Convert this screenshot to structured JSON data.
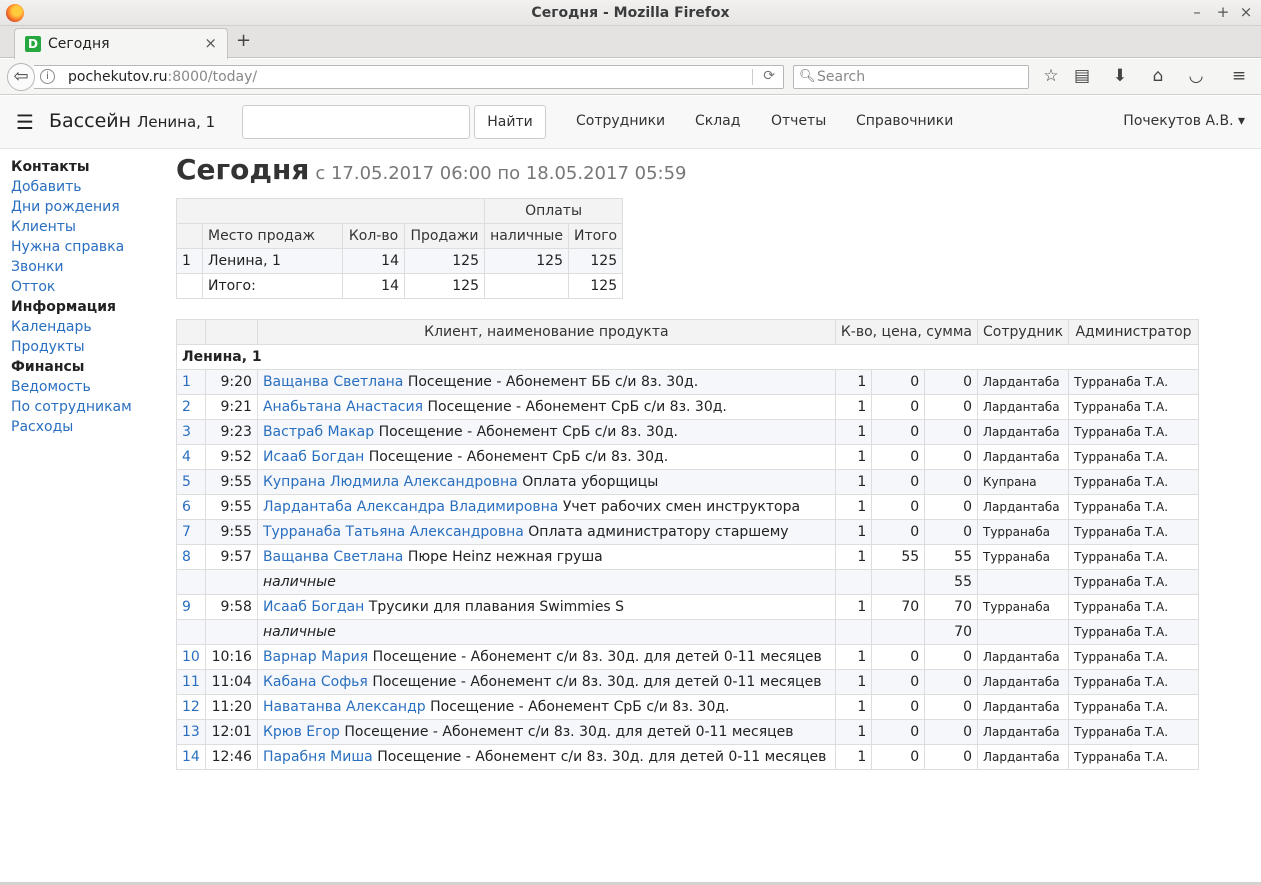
{
  "window": {
    "title": "Сегодня - Mozilla Firefox",
    "controls": [
      "–",
      "+",
      "×"
    ]
  },
  "tab": {
    "label": "Сегодня",
    "favicon_letter": "D",
    "close": "×",
    "new": "+"
  },
  "nav": {
    "url_host": "pochekutov.ru",
    "url_rest": ":8000/today/",
    "search_placeholder": "Search"
  },
  "app": {
    "brand": "Бассейн",
    "location": "Ленина, 1",
    "search_button": "Найти",
    "menu": [
      "Сотрудники",
      "Склад",
      "Отчеты",
      "Справочники"
    ],
    "user": "Почекутов А.В. ▾"
  },
  "sidebar": [
    {
      "text": "Контакты",
      "kind": "hd"
    },
    {
      "text": "Добавить",
      "kind": "lk"
    },
    {
      "text": "Дни рождения",
      "kind": "lk"
    },
    {
      "text": "Клиенты",
      "kind": "lk"
    },
    {
      "text": "Нужна справка",
      "kind": "lk"
    },
    {
      "text": "Звонки",
      "kind": "lk"
    },
    {
      "text": "Отток",
      "kind": "lk"
    },
    {
      "text": "Информация",
      "kind": "hd"
    },
    {
      "text": "Календарь",
      "kind": "lk"
    },
    {
      "text": "Продукты",
      "kind": "lk"
    },
    {
      "text": "Финансы",
      "kind": "hd"
    },
    {
      "text": "Ведомость",
      "kind": "lk"
    },
    {
      "text": "По сотрудникам",
      "kind": "lk"
    },
    {
      "text": "Расходы",
      "kind": "lk"
    }
  ],
  "page": {
    "title": "Сегодня",
    "subtitle": "с 17.05.2017 06:00 по 18.05.2017 05:59"
  },
  "summary": {
    "group_header": "Оплаты",
    "headers": [
      "Место продаж",
      "Кол-во",
      "Продажи",
      "наличные",
      "Итого"
    ],
    "rows": [
      {
        "n": "1",
        "place": "Ленина, 1",
        "qty": "14",
        "sales": "125",
        "cash": "125",
        "total": "125"
      },
      {
        "n": "",
        "place": "Итого:",
        "qty": "14",
        "sales": "125",
        "cash": "",
        "total": "125"
      }
    ]
  },
  "details": {
    "headers": [
      "Клиент, наименование продукта",
      "К-во, цена, сумма",
      "Сотрудник",
      "Администратор"
    ],
    "group": "Ленина, 1",
    "rows": [
      {
        "type": "item",
        "n": "1",
        "time": "9:20",
        "client": "Ващанва Светлана",
        "product": "Посещение - Абонемент ББ с/и 8з. 30д.",
        "qty": "1",
        "price": "0",
        "sum": "0",
        "staff": "Лардантаба",
        "admin": "Турранаба Т.А."
      },
      {
        "type": "item",
        "n": "2",
        "time": "9:21",
        "client": "Анабьтана Анастасия",
        "product": "Посещение - Абонемент СрБ с/и 8з. 30д.",
        "qty": "1",
        "price": "0",
        "sum": "0",
        "staff": "Лардантаба",
        "admin": "Турранаба Т.А."
      },
      {
        "type": "item",
        "n": "3",
        "time": "9:23",
        "client": "Вастраб Макар",
        "product": "Посещение - Абонемент СрБ с/и 8з. 30д.",
        "qty": "1",
        "price": "0",
        "sum": "0",
        "staff": "Лардантаба",
        "admin": "Турранаба Т.А."
      },
      {
        "type": "item",
        "n": "4",
        "time": "9:52",
        "client": "Исааб Богдан",
        "product": "Посещение - Абонемент СрБ с/и 8з. 30д.",
        "qty": "1",
        "price": "0",
        "sum": "0",
        "staff": "Лардантаба",
        "admin": "Турранаба Т.А."
      },
      {
        "type": "item",
        "n": "5",
        "time": "9:55",
        "client": "Купрана Людмила Александровна",
        "product": "Оплата уборщицы",
        "qty": "1",
        "price": "0",
        "sum": "0",
        "staff": "Купрана",
        "admin": "Турранаба Т.А."
      },
      {
        "type": "item",
        "n": "6",
        "time": "9:55",
        "client": "Лардантаба Александра Владимировна",
        "product": "Учет рабочих смен инструктора",
        "qty": "1",
        "price": "0",
        "sum": "0",
        "staff": "Лардантаба",
        "admin": "Турранаба Т.А."
      },
      {
        "type": "item",
        "n": "7",
        "time": "9:55",
        "client": "Турранаба Татьяна Александровна",
        "product": "Оплата администратору старшему",
        "qty": "1",
        "price": "0",
        "sum": "0",
        "staff": "Турранаба",
        "admin": "Турранаба Т.А."
      },
      {
        "type": "item",
        "n": "8",
        "time": "9:57",
        "client": "Ващанва Светлана",
        "product": "Пюре Heinz нежная груша",
        "qty": "1",
        "price": "55",
        "sum": "55",
        "staff": "Турранаба",
        "admin": "Турранаба Т.А."
      },
      {
        "type": "pay",
        "label": "наличные",
        "sum": "55",
        "admin": "Турранаба Т.А."
      },
      {
        "type": "item",
        "n": "9",
        "time": "9:58",
        "client": "Исааб Богдан",
        "product": "Трусики для плавания Swimmies S",
        "qty": "1",
        "price": "70",
        "sum": "70",
        "staff": "Турранаба",
        "admin": "Турранаба Т.А."
      },
      {
        "type": "pay",
        "label": "наличные",
        "sum": "70",
        "admin": "Турранаба Т.А."
      },
      {
        "type": "item",
        "n": "10",
        "time": "10:16",
        "client": "Варнар Мария",
        "product": "Посещение - Абонемент с/и 8з. 30д. для детей 0-11 месяцев",
        "qty": "1",
        "price": "0",
        "sum": "0",
        "staff": "Лардантаба",
        "admin": "Турранаба Т.А."
      },
      {
        "type": "item",
        "n": "11",
        "time": "11:04",
        "client": "Кабана Софья",
        "product": "Посещение - Абонемент с/и 8з. 30д. для детей 0-11 месяцев",
        "qty": "1",
        "price": "0",
        "sum": "0",
        "staff": "Лардантаба",
        "admin": "Турранаба Т.А."
      },
      {
        "type": "item",
        "n": "12",
        "time": "11:20",
        "client": "Наватанва Александр",
        "product": "Посещение - Абонемент СрБ с/и 8з. 30д.",
        "qty": "1",
        "price": "0",
        "sum": "0",
        "staff": "Лардантаба",
        "admin": "Турранаба Т.А."
      },
      {
        "type": "item",
        "n": "13",
        "time": "12:01",
        "client": "Крюв Егор",
        "product": "Посещение - Абонемент с/и 8з. 30д. для детей 0-11 месяцев",
        "qty": "1",
        "price": "0",
        "sum": "0",
        "staff": "Лардантаба",
        "admin": "Турранаба Т.А."
      },
      {
        "type": "item",
        "n": "14",
        "time": "12:46",
        "client": "Парабня Миша",
        "product": "Посещение - Абонемент с/и 8з. 30д. для детей 0-11 месяцев",
        "qty": "1",
        "price": "0",
        "sum": "0",
        "staff": "Лардантаба",
        "admin": "Турранаба Т.А."
      }
    ]
  }
}
